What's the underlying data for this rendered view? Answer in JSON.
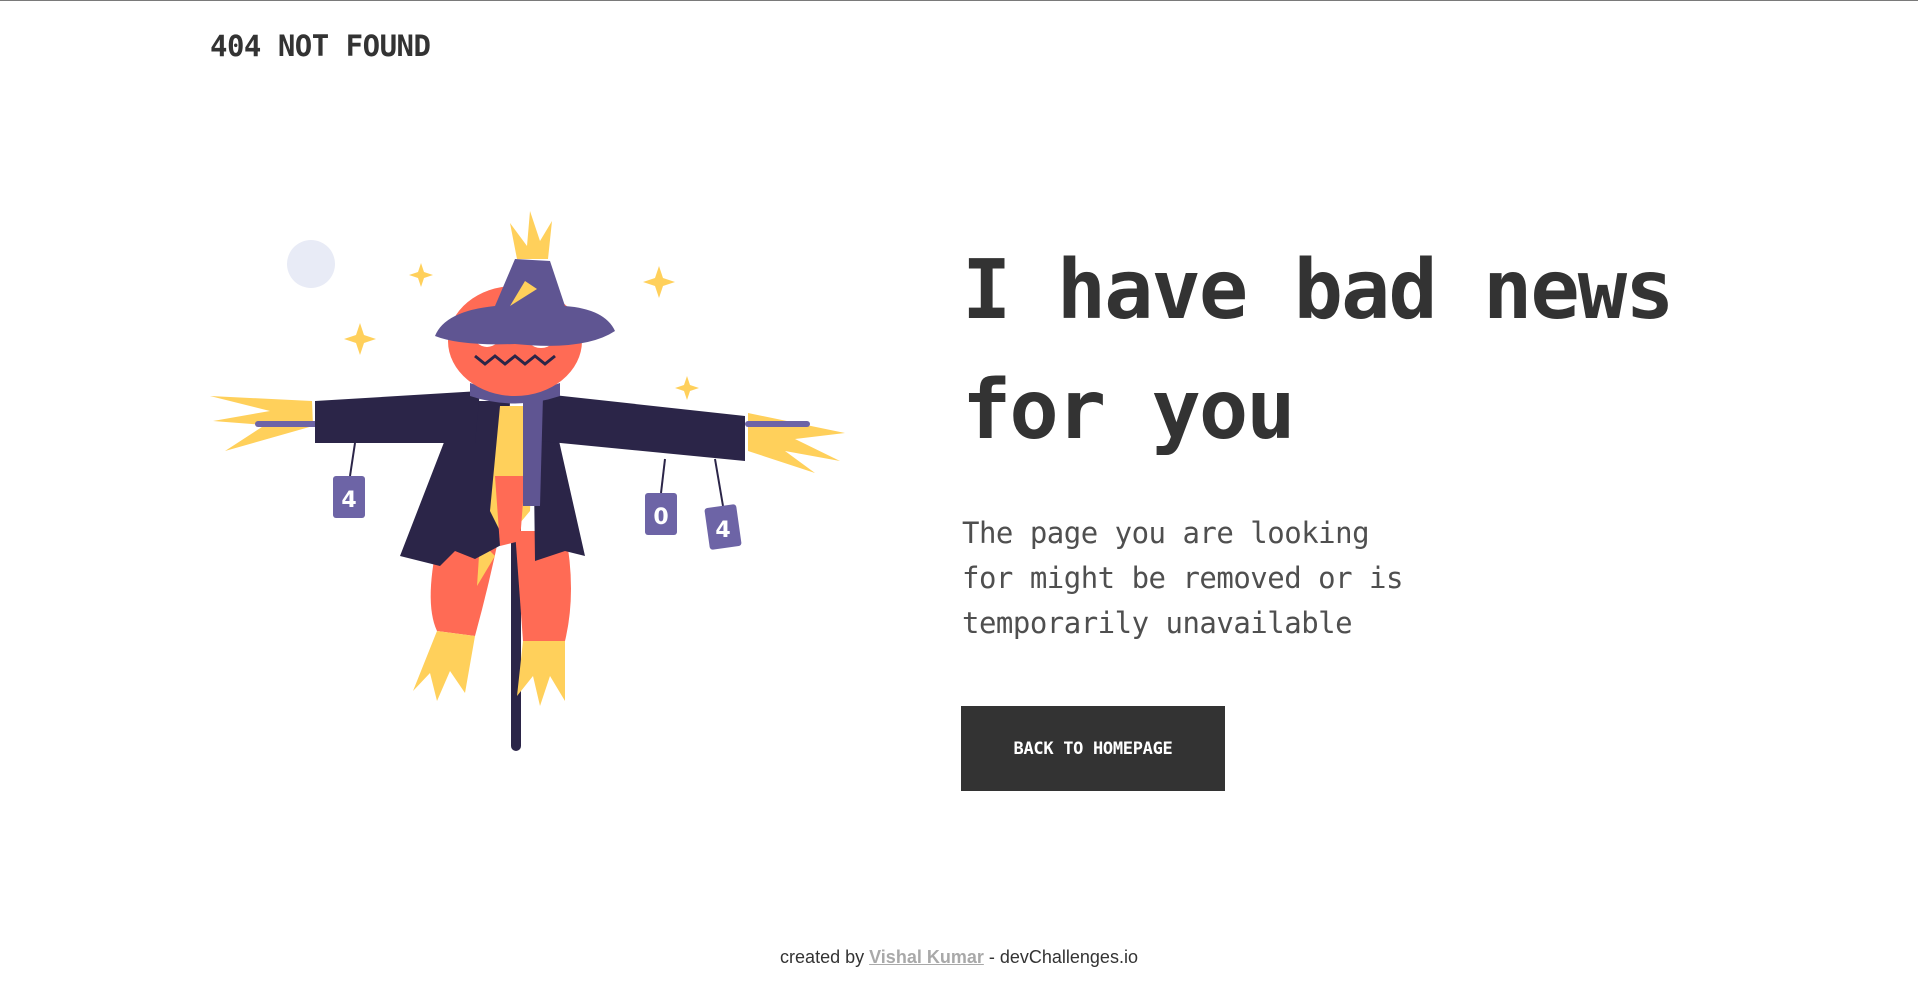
{
  "header": {
    "logo": "404 NOT FOUND"
  },
  "main": {
    "headline_line1": "I have bad news",
    "headline_line2": "for you",
    "message_line1": "The page you are looking",
    "message_line2": "for might be removed or is",
    "message_line3": "temporarily unavailable",
    "button_label": "BACK TO HOMEPAGE"
  },
  "illustration": {
    "can_left": "4",
    "can_mid": "0",
    "can_right": "4"
  },
  "footer": {
    "prefix": "created by",
    "author": "Vishal Kumar",
    "suffix": "- devChallenges.io"
  },
  "colors": {
    "text": "#333333",
    "button_bg": "#333333",
    "hat": "#5f5592",
    "coat": "#2b2548",
    "pumpkin": "#ff6b55",
    "straw": "#ffd05b",
    "moon": "#e8ebf6"
  }
}
